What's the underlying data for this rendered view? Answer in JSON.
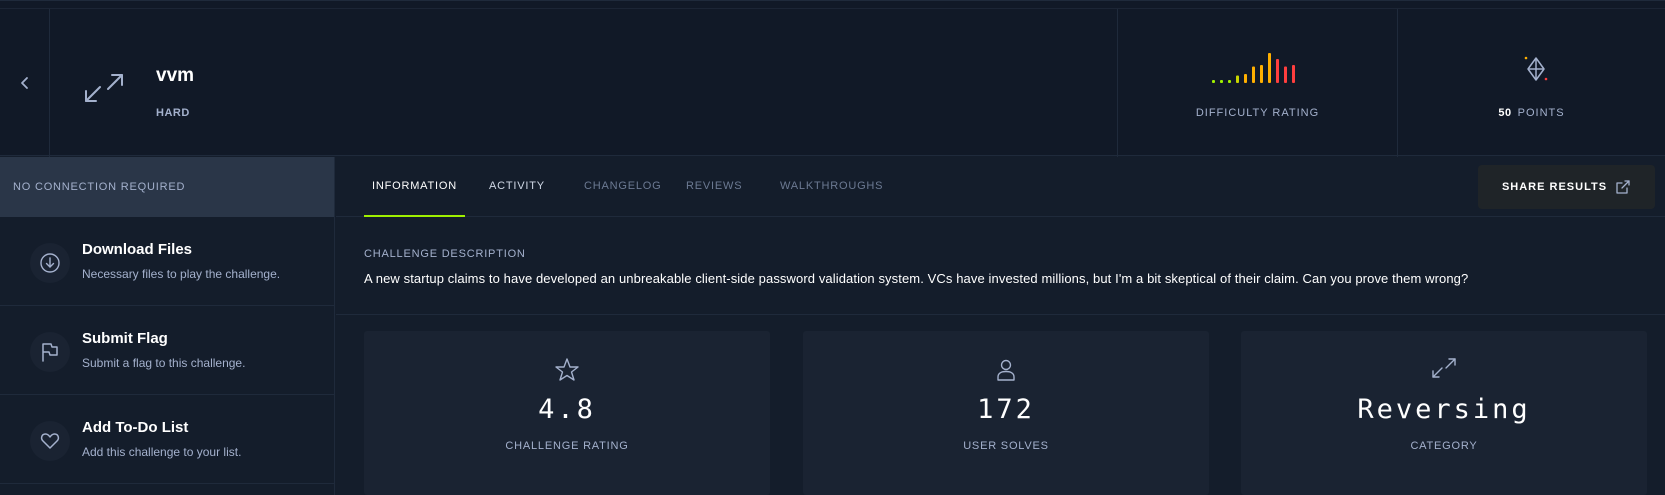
{
  "challenge": {
    "name": "vvm",
    "difficulty": "HARD",
    "difficulty_rating_label": "DIFFICULTY RATING",
    "difficulty_distribution": [
      0.1,
      0.1,
      0.1,
      0.25,
      0.3,
      0.55,
      0.6,
      1.0,
      0.8,
      0.55,
      0.6
    ],
    "difficulty_colors": [
      "#9fef00",
      "#9fef00",
      "#9fef00",
      "#c9d600",
      "#ffaf00",
      "#ffaf00",
      "#ffaf00",
      "#ffaf00",
      "#ff3e3e",
      "#ff3e3e",
      "#ff3e3e"
    ],
    "points_value": "50",
    "points_label": "POINTS"
  },
  "sidebar": {
    "connection_banner": "NO CONNECTION REQUIRED",
    "items": [
      {
        "title": "Download Files",
        "subtitle": "Necessary files to play the challenge.",
        "icon": "download-icon"
      },
      {
        "title": "Submit Flag",
        "subtitle": "Submit a flag to this challenge.",
        "icon": "flag-icon"
      },
      {
        "title": "Add To-Do List",
        "subtitle": "Add this challenge to your list.",
        "icon": "heart-icon"
      }
    ]
  },
  "tabs": [
    {
      "label": "INFORMATION",
      "state": "active"
    },
    {
      "label": "ACTIVITY",
      "state": "normal"
    },
    {
      "label": "CHANGELOG",
      "state": "dim"
    },
    {
      "label": "REVIEWS",
      "state": "dim"
    },
    {
      "label": "WALKTHROUGHS",
      "state": "dim"
    }
  ],
  "share_button": "SHARE RESULTS",
  "description": {
    "heading": "CHALLENGE DESCRIPTION",
    "text": "A new startup claims to have developed an unbreakable client-side password validation system. VCs have invested millions, but I'm a bit skeptical of their claim. Can you prove them wrong?"
  },
  "stats": [
    {
      "value": "4.8",
      "label": "CHALLENGE RATING",
      "icon": "star-icon"
    },
    {
      "value": "172",
      "label": "USER SOLVES",
      "icon": "user-icon"
    },
    {
      "value": "Reversing",
      "label": "CATEGORY",
      "icon": "expand-arrows-icon"
    }
  ],
  "colors": {
    "accent": "#9fef00",
    "background": "#141d2b",
    "panel": "#1a2332",
    "text_muted": "#a4b1cd"
  }
}
